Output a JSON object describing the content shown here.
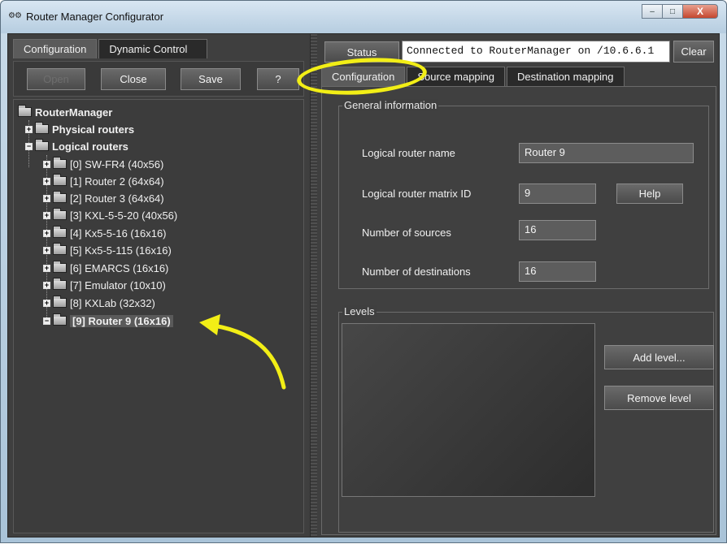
{
  "window": {
    "title": "Router Manager Configurator",
    "icon": "router-app-icon",
    "controls": {
      "minimize": "–",
      "maximize": "□",
      "close": "X"
    }
  },
  "left": {
    "tabs": [
      {
        "label": "Configuration",
        "active": true
      },
      {
        "label": "Dynamic Control",
        "active": false
      }
    ],
    "toolbar": {
      "open_label": "Open",
      "close_label": "Close",
      "save_label": "Save",
      "help_label": "?"
    },
    "tree": {
      "root": "RouterManager",
      "physical": "Physical routers",
      "logical": "Logical routers",
      "items": [
        "[0] SW-FR4 (40x56)",
        "[1] Router 2 (64x64)",
        "[2] Router 3 (64x64)",
        "[3] KXL-5-5-20 (40x56)",
        "[4] Kx5-5-16 (16x16)",
        "[5] Kx5-5-115 (16x16)",
        "[6] EMARCS (16x16)",
        "[7] Emulator (10x10)",
        "[8] KXLab (32x32)",
        "[9] Router 9 (16x16)"
      ]
    }
  },
  "right": {
    "status": {
      "label": "Status",
      "value": "Connected to RouterManager on /10.6.6.1",
      "clear_label": "Clear"
    },
    "tabs": [
      {
        "label": "Configuration",
        "active": true
      },
      {
        "label": "Source mapping",
        "active": false
      },
      {
        "label": "Destination mapping",
        "active": false
      }
    ],
    "general": {
      "title": "General information",
      "name_label": "Logical router name",
      "name_value": "Router 9",
      "matrix_label": "Logical router matrix ID",
      "matrix_value": "9",
      "help_label": "Help",
      "sources_label": "Number of sources",
      "sources_value": "16",
      "dest_label": "Number of destinations",
      "dest_value": "16"
    },
    "levels": {
      "title": "Levels",
      "add_label": "Add level...",
      "remove_label": "Remove level"
    }
  },
  "colors": {
    "panel_bg": "#3f3f3f",
    "annotation": "#f2ee16"
  }
}
